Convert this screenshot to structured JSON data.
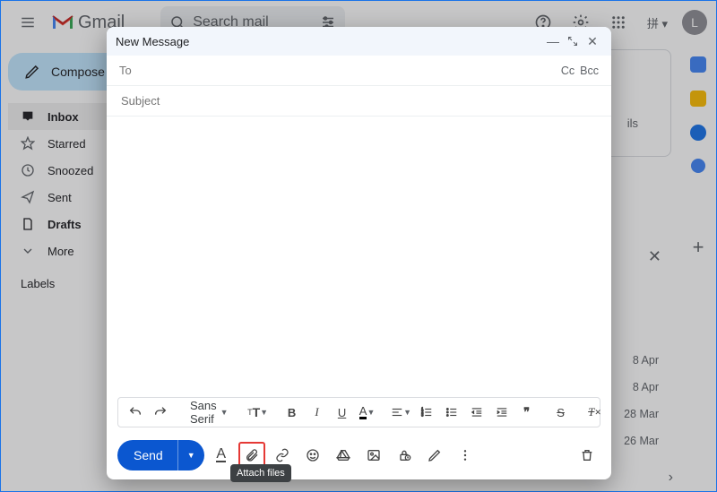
{
  "header": {
    "logo_text": "Gmail",
    "search_placeholder": "Search mail",
    "avatar_letter": "L",
    "input_method": "拼 ▾"
  },
  "sidebar": {
    "compose": "Compose",
    "items": [
      {
        "label": "Inbox"
      },
      {
        "label": "Starred"
      },
      {
        "label": "Snoozed"
      },
      {
        "label": "Sent"
      },
      {
        "label": "Drafts"
      },
      {
        "label": "More"
      }
    ],
    "labels_header": "Labels"
  },
  "content": {
    "details": "ils",
    "dates": [
      "8 Apr",
      "8 Apr",
      "28 Mar",
      "26 Mar"
    ]
  },
  "compose_dialog": {
    "title": "New Message",
    "to_label": "To",
    "cc": "Cc",
    "bcc": "Bcc",
    "subject_placeholder": "Subject",
    "font": "Sans Serif",
    "send": "Send",
    "attach_tooltip": "Attach files"
  },
  "icons": {
    "menu": "menu-icon",
    "search": "search-icon",
    "tune": "tune-icon",
    "help": "help-icon",
    "settings": "gear-icon",
    "apps": "apps-icon",
    "pencil": "pencil-icon",
    "inbox": "inbox-icon",
    "star": "star-icon",
    "clock": "clock-icon",
    "send": "send-icon",
    "file": "file-icon",
    "expand": "expand-more-icon",
    "minimize": "minimize-icon",
    "fullscreen": "exit-fullscreen-icon",
    "close": "close-icon",
    "undo": "undo-icon",
    "redo": "redo-icon",
    "textsize": "text-size-icon",
    "bold": "bold-icon",
    "italic": "italic-icon",
    "underline": "underline-icon",
    "color": "text-color-icon",
    "align": "align-icon",
    "numlist": "numbered-list-icon",
    "bullist": "bulleted-list-icon",
    "outdent": "outdent-icon",
    "indent": "indent-icon",
    "quote": "quote-icon",
    "strike": "strikethrough-icon",
    "clear": "clear-format-icon",
    "formatA": "format-toggle-icon",
    "attach": "attach-icon",
    "link": "link-icon",
    "emoji": "emoji-icon",
    "drive": "drive-icon",
    "image": "image-icon",
    "lock": "confidential-icon",
    "ink": "signature-icon",
    "more": "more-icon",
    "trash": "trash-icon"
  }
}
